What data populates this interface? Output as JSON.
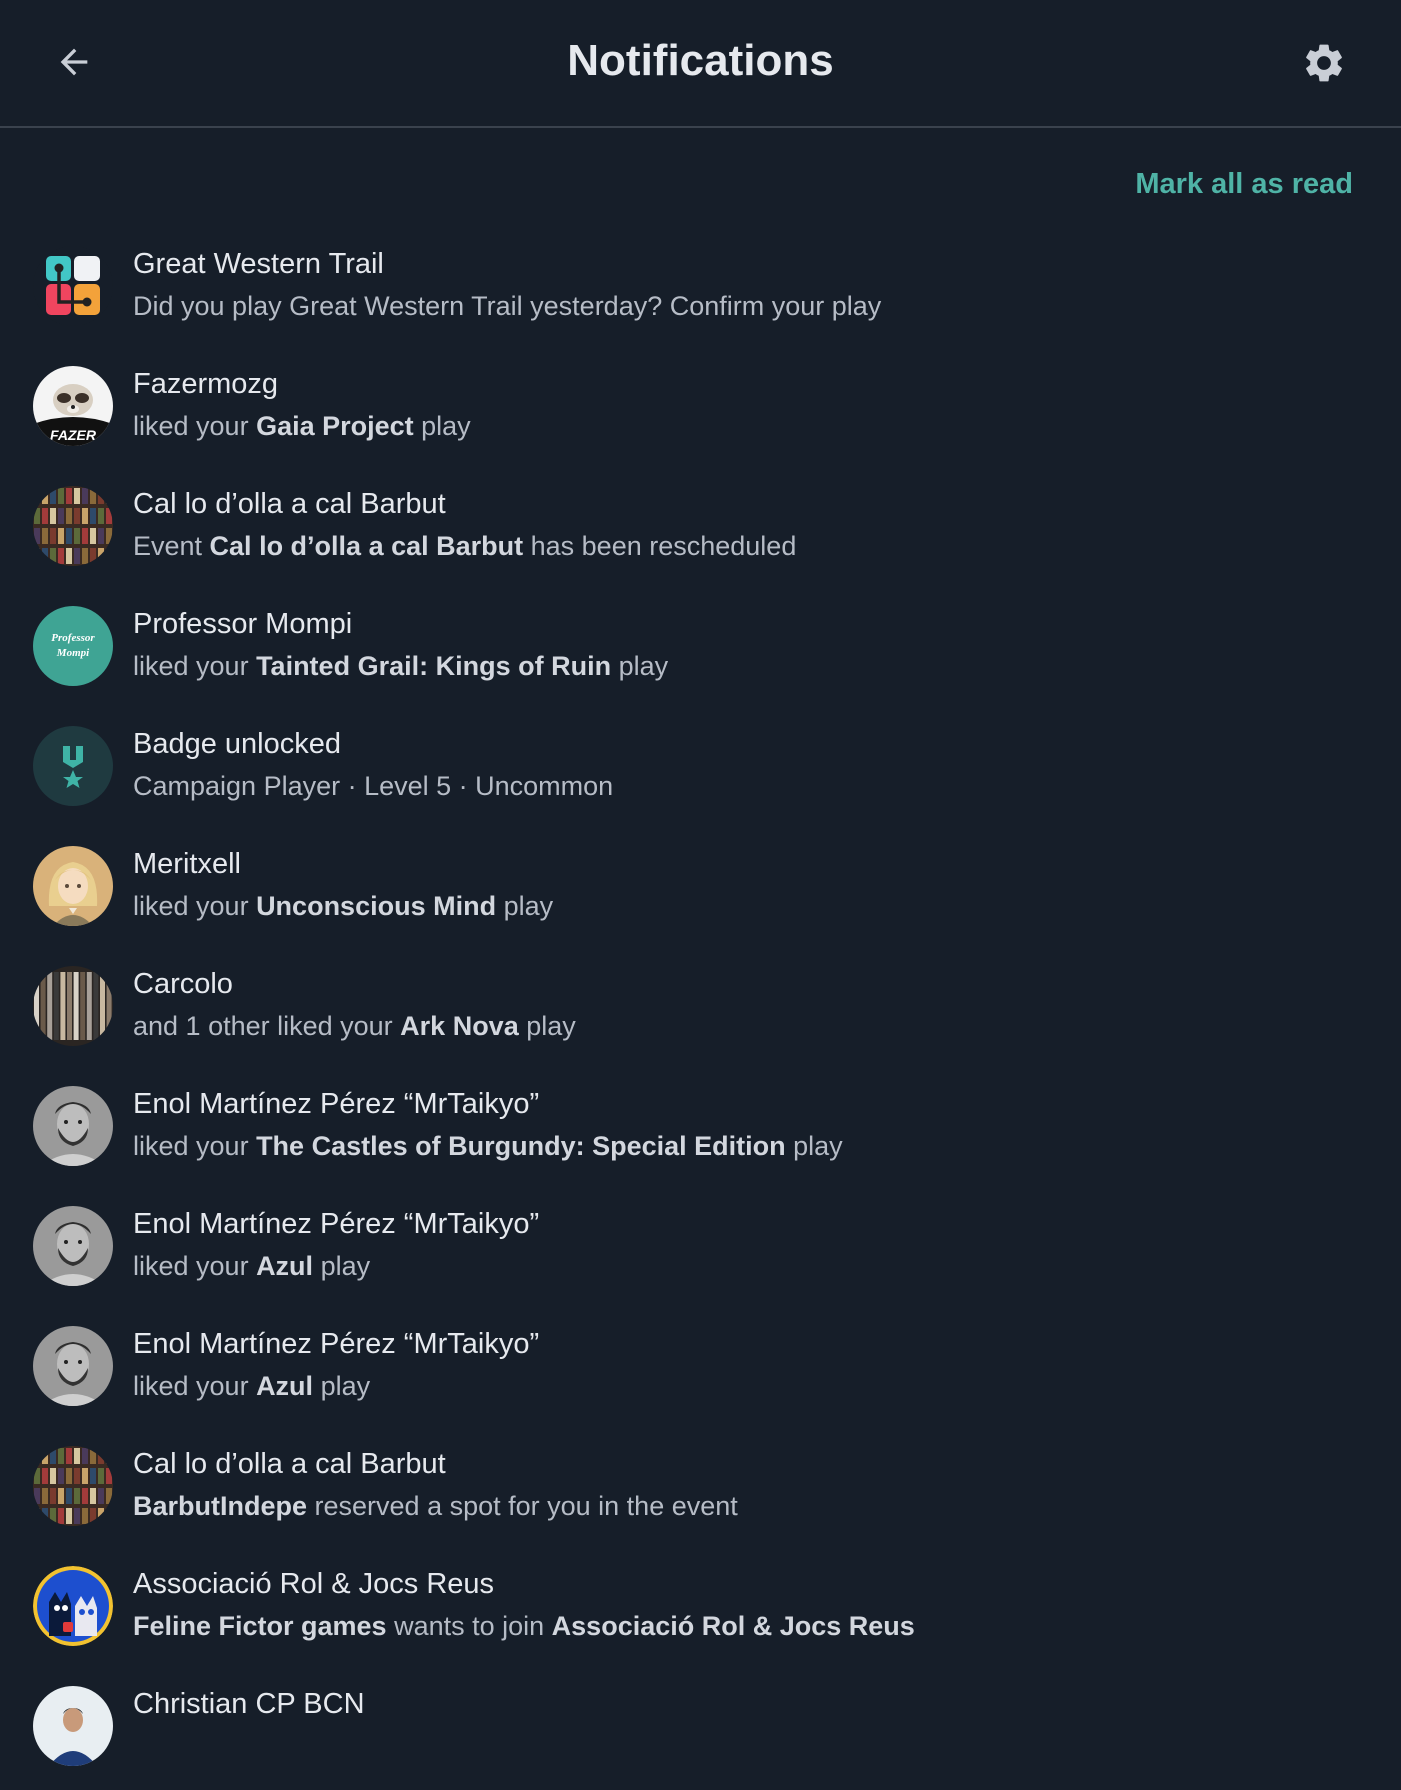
{
  "header": {
    "title": "Notifications",
    "back_icon": "arrow-left-icon",
    "settings_icon": "gear-icon"
  },
  "actions": {
    "mark_all_read": "Mark all as read"
  },
  "colors": {
    "background": "#161e29",
    "accent": "#4fb3a6",
    "divider": "#3a424d"
  },
  "notifications": [
    {
      "name": "Great Western Trail",
      "desc": [
        {
          "t": "Did you play Great Western Trail yesterday? Confirm your play"
        }
      ],
      "avatar": "app-logo"
    },
    {
      "name": "Fazermozg",
      "desc": [
        {
          "t": "liked your "
        },
        {
          "t": "Gaia Project",
          "b": true
        },
        {
          "t": " play"
        }
      ],
      "avatar": "ferret-photo",
      "avatar_text": "FAZER"
    },
    {
      "name": "Cal lo d’olla a cal Barbut",
      "desc": [
        {
          "t": "Event "
        },
        {
          "t": "Cal lo d’olla a cal Barbut",
          "b": true
        },
        {
          "t": " has been rescheduled"
        }
      ],
      "avatar": "bookshelf-photo"
    },
    {
      "name": "Professor Mompi",
      "desc": [
        {
          "t": "liked your "
        },
        {
          "t": "Tainted Grail: Kings of Ruin",
          "b": true
        },
        {
          "t": " play"
        }
      ],
      "avatar": "text-logo",
      "avatar_text": "Professor Mompi"
    },
    {
      "name": "Badge unlocked",
      "desc": [
        {
          "t": "Campaign Player · Level 5 · Uncommon"
        }
      ],
      "avatar": "medal-icon"
    },
    {
      "name": "Meritxell",
      "desc": [
        {
          "t": "liked your "
        },
        {
          "t": "Unconscious Mind",
          "b": true
        },
        {
          "t": " play"
        }
      ],
      "avatar": "illustrated-portrait"
    },
    {
      "name": "Carcolo",
      "desc": [
        {
          "t": "and 1 other liked your "
        },
        {
          "t": "Ark Nova",
          "b": true
        },
        {
          "t": " play"
        }
      ],
      "avatar": "shelf-photo"
    },
    {
      "name": "Enol Martínez Pérez “MrTaikyo”",
      "desc": [
        {
          "t": "liked your "
        },
        {
          "t": "The Castles of Burgundy: Special Edition",
          "b": true
        },
        {
          "t": " play"
        }
      ],
      "avatar": "bearded-portrait"
    },
    {
      "name": "Enol Martínez Pérez “MrTaikyo”",
      "desc": [
        {
          "t": "liked your "
        },
        {
          "t": "Azul",
          "b": true
        },
        {
          "t": " play"
        }
      ],
      "avatar": "bearded-portrait"
    },
    {
      "name": "Enol Martínez Pérez “MrTaikyo”",
      "desc": [
        {
          "t": "liked your "
        },
        {
          "t": "Azul",
          "b": true
        },
        {
          "t": " play"
        }
      ],
      "avatar": "bearded-portrait"
    },
    {
      "name": "Cal lo d’olla a cal Barbut",
      "desc": [
        {
          "t": "BarbutIndepe",
          "b": true
        },
        {
          "t": " reserved a spot for you in the event"
        }
      ],
      "avatar": "bookshelf-photo"
    },
    {
      "name": "Associació Rol & Jocs Reus",
      "desc": [
        {
          "t": "Feline Fictor games",
          "b": true
        },
        {
          "t": " wants to join "
        },
        {
          "t": "Associació Rol & Jocs Reus",
          "b": true
        }
      ],
      "avatar": "cats-illustration"
    },
    {
      "name": "Christian CP BCN",
      "desc": [],
      "avatar": "person-photo"
    }
  ]
}
